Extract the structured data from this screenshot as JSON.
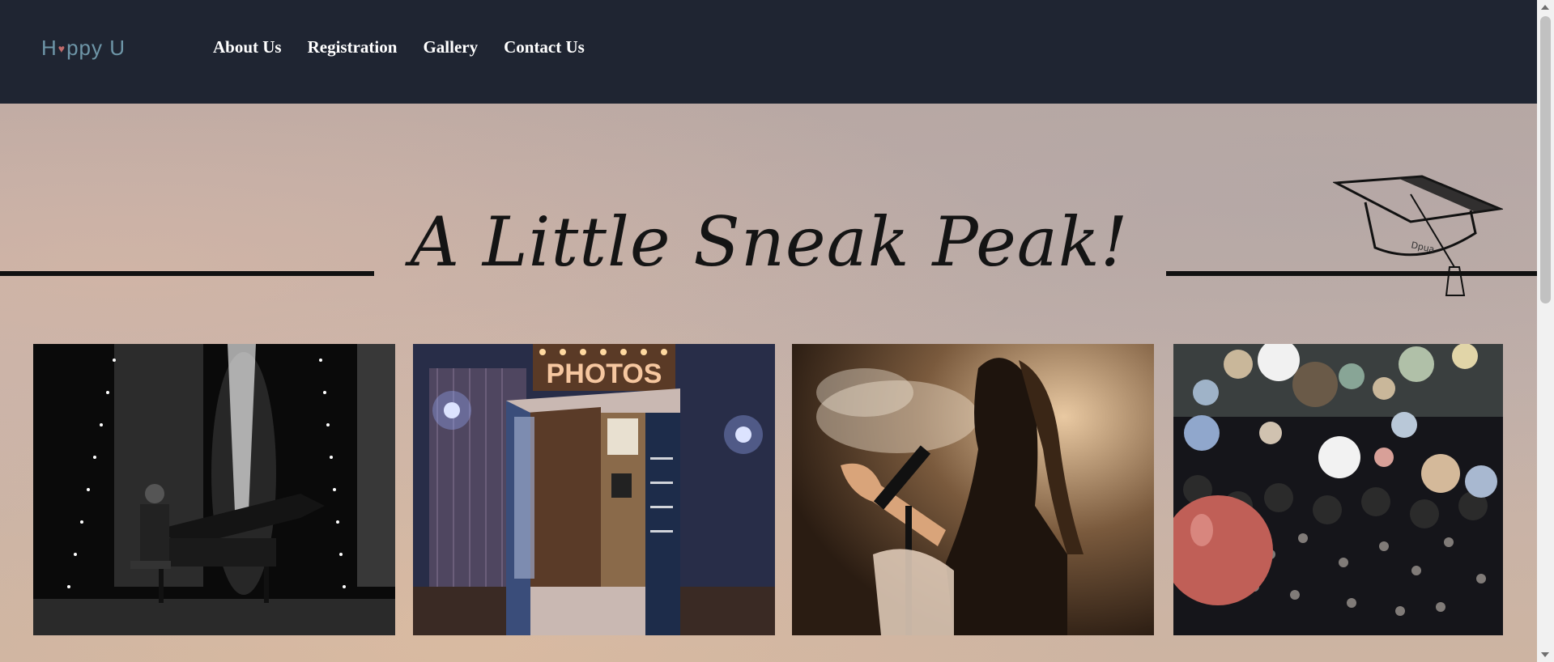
{
  "header": {
    "logo_text_1": "H",
    "logo_text_2": "ppy U",
    "logo_heart": "♥",
    "nav": [
      {
        "label": "About Us"
      },
      {
        "label": "Registration"
      },
      {
        "label": "Gallery"
      },
      {
        "label": "Contact Us"
      }
    ],
    "background_color": "#1f2532"
  },
  "hero": {
    "headline": "A Little Sneak Peak!",
    "cap_icon": "graduation-cap-icon",
    "cap_band_text": "Dpua",
    "booth_sign": "PHOTOS",
    "photos": [
      {
        "name": "piano-performance-photo"
      },
      {
        "name": "photo-booth-photo"
      },
      {
        "name": "singer-photo"
      },
      {
        "name": "balloon-party-photo"
      }
    ]
  },
  "colors": {
    "accent_text": "#141414",
    "nav_text": "#ffffff",
    "logo": "#6e96a8"
  }
}
